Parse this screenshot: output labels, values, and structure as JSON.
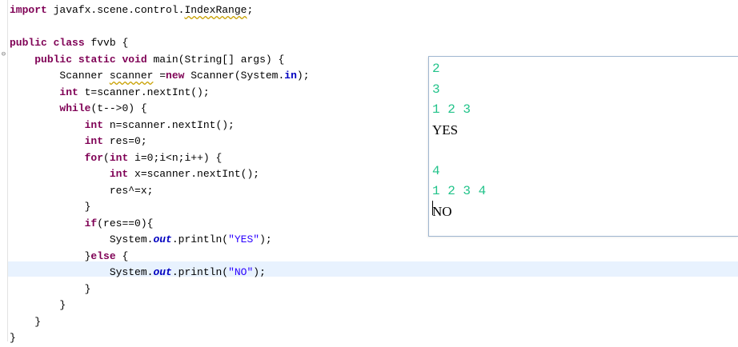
{
  "editor": {
    "lines": [
      {
        "t": [
          {
            "c": "kw",
            "v": "import"
          },
          {
            "c": "",
            "v": " javafx.scene.control."
          },
          {
            "c": "warn",
            "v": "IndexRange"
          },
          {
            "c": "",
            "v": ";"
          }
        ]
      },
      {
        "t": []
      },
      {
        "t": [
          {
            "c": "kw",
            "v": "public"
          },
          {
            "c": "",
            "v": " "
          },
          {
            "c": "kw",
            "v": "class"
          },
          {
            "c": "",
            "v": " fvvb {"
          }
        ]
      },
      {
        "t": [
          {
            "c": "",
            "v": "    "
          },
          {
            "c": "kw",
            "v": "public"
          },
          {
            "c": "",
            "v": " "
          },
          {
            "c": "kw",
            "v": "static"
          },
          {
            "c": "",
            "v": " "
          },
          {
            "c": "kw",
            "v": "void"
          },
          {
            "c": "",
            "v": " main(String[] args) {"
          }
        ]
      },
      {
        "t": [
          {
            "c": "",
            "v": "        Scanner "
          },
          {
            "c": "warn",
            "v": "scanner"
          },
          {
            "c": "",
            "v": " ="
          },
          {
            "c": "kw",
            "v": "new"
          },
          {
            "c": "",
            "v": " Scanner(System."
          },
          {
            "c": "fld",
            "v": "in"
          },
          {
            "c": "",
            "v": ");"
          }
        ]
      },
      {
        "t": [
          {
            "c": "",
            "v": "        "
          },
          {
            "c": "kw",
            "v": "int"
          },
          {
            "c": "",
            "v": " t=scanner.nextInt();"
          }
        ]
      },
      {
        "t": [
          {
            "c": "",
            "v": "        "
          },
          {
            "c": "kw",
            "v": "while"
          },
          {
            "c": "",
            "v": "(t-->0) {"
          }
        ]
      },
      {
        "t": [
          {
            "c": "",
            "v": "            "
          },
          {
            "c": "kw",
            "v": "int"
          },
          {
            "c": "",
            "v": " n=scanner.nextInt();"
          }
        ]
      },
      {
        "t": [
          {
            "c": "",
            "v": "            "
          },
          {
            "c": "kw",
            "v": "int"
          },
          {
            "c": "",
            "v": " res=0;"
          }
        ]
      },
      {
        "t": [
          {
            "c": "",
            "v": "            "
          },
          {
            "c": "kw",
            "v": "for"
          },
          {
            "c": "",
            "v": "("
          },
          {
            "c": "kw",
            "v": "int"
          },
          {
            "c": "",
            "v": " i=0;i<n;i++) {"
          }
        ]
      },
      {
        "t": [
          {
            "c": "",
            "v": "                "
          },
          {
            "c": "kw",
            "v": "int"
          },
          {
            "c": "",
            "v": " x=scanner.nextInt();"
          }
        ]
      },
      {
        "t": [
          {
            "c": "",
            "v": "                res^=x;"
          }
        ]
      },
      {
        "t": [
          {
            "c": "",
            "v": "            }"
          }
        ]
      },
      {
        "t": [
          {
            "c": "",
            "v": "            "
          },
          {
            "c": "kw",
            "v": "if"
          },
          {
            "c": "",
            "v": "(res==0){"
          }
        ]
      },
      {
        "t": [
          {
            "c": "",
            "v": "                System."
          },
          {
            "c": "sfld",
            "v": "out"
          },
          {
            "c": "",
            "v": ".println("
          },
          {
            "c": "str",
            "v": "\"YES\""
          },
          {
            "c": "",
            "v": ");"
          }
        ]
      },
      {
        "t": [
          {
            "c": "",
            "v": "            }"
          },
          {
            "c": "kw",
            "v": "else"
          },
          {
            "c": "",
            "v": " {"
          }
        ]
      },
      {
        "t": [
          {
            "c": "",
            "v": "                System."
          },
          {
            "c": "sfld",
            "v": "out"
          },
          {
            "c": "",
            "v": ".println("
          },
          {
            "c": "str",
            "v": "\"NO\""
          },
          {
            "c": "",
            "v": ");"
          }
        ]
      },
      {
        "t": [
          {
            "c": "",
            "v": "            }"
          }
        ]
      },
      {
        "t": [
          {
            "c": "",
            "v": "        }"
          }
        ]
      },
      {
        "t": [
          {
            "c": "",
            "v": "    }"
          }
        ]
      },
      {
        "t": [
          {
            "c": "",
            "v": "}"
          }
        ]
      }
    ],
    "fold_marker": "⊖"
  },
  "console": {
    "lines": [
      {
        "kind": "in",
        "text": "2"
      },
      {
        "kind": "in",
        "text": "3"
      },
      {
        "kind": "in",
        "text": "1 2 3"
      },
      {
        "kind": "out",
        "text": "YES"
      },
      {
        "kind": "blank",
        "text": ""
      },
      {
        "kind": "in",
        "text": "4"
      },
      {
        "kind": "in",
        "text": "1 2 3 4"
      },
      {
        "kind": "out",
        "text": "NO"
      }
    ]
  },
  "colors": {
    "keyword": "#7f0055",
    "string": "#2a00ff",
    "field": "#0000c0",
    "console_input": "#22c38a",
    "current_line": "#e8f2fe"
  }
}
